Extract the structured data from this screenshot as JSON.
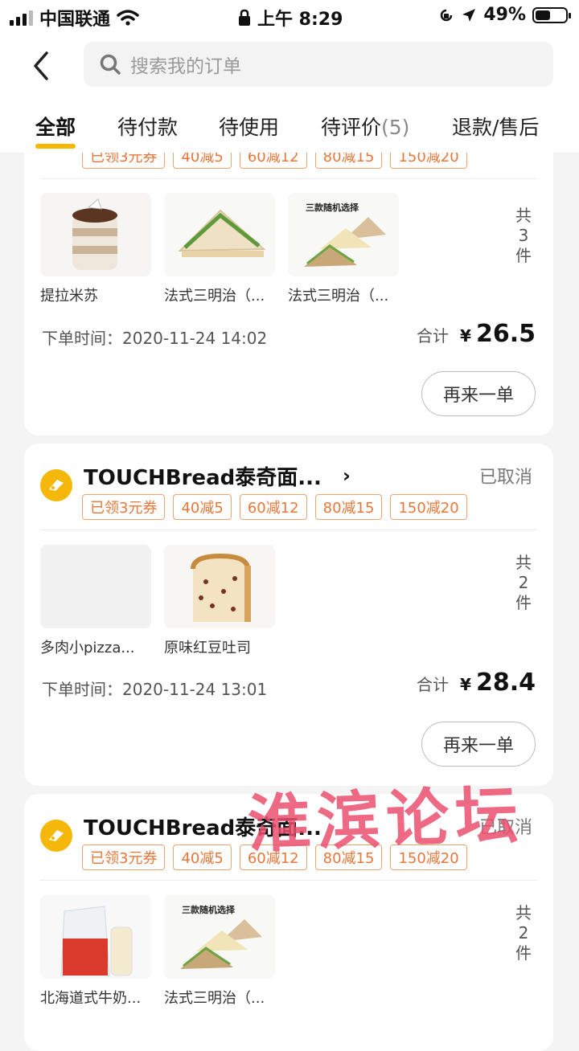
{
  "status_bar": {
    "carrier": "中国联通",
    "time": "上午 8:29",
    "battery": "49%",
    "battery_level": 0.49
  },
  "header": {
    "search_placeholder": "搜索我的订单",
    "tabs": [
      {
        "label": "全部",
        "count": "",
        "active": true
      },
      {
        "label": "待付款",
        "count": ""
      },
      {
        "label": "待使用",
        "count": ""
      },
      {
        "label": "待评价",
        "count": "(5)"
      },
      {
        "label": "退款/售后",
        "count": ""
      }
    ]
  },
  "orders": [
    {
      "shop_name": "",
      "status": "",
      "coupons": [
        "已领3元券",
        "40减5",
        "60减12",
        "80减15",
        "150减20"
      ],
      "items": [
        {
          "name": "提拉米苏",
          "image": "tiramisu"
        },
        {
          "name": "法式三明治（...",
          "image": "sandwich"
        },
        {
          "name": "法式三明治（...",
          "image": "sandwich-assorted",
          "caption": "三款随机选择"
        }
      ],
      "item_count": [
        "共",
        "3",
        "件"
      ],
      "order_time": "下单时间：2020-11-24 14:02",
      "total_label": "合计",
      "currency": "¥",
      "total": "26.5",
      "reorder_label": "再来一单"
    },
    {
      "shop_name": "TOUCHBread泰奇面...",
      "status": "已取消",
      "coupons": [
        "已领3元券",
        "40减5",
        "60减12",
        "80减15",
        "150减20"
      ],
      "items": [
        {
          "name": "多肉小pizza...",
          "image": "blank"
        },
        {
          "name": "原味红豆吐司",
          "image": "red-bean-toast"
        }
      ],
      "item_count": [
        "共",
        "2",
        "件"
      ],
      "order_time": "下单时间：2020-11-24 13:01",
      "total_label": "合计",
      "currency": "¥",
      "total": "28.4",
      "reorder_label": "再来一单"
    },
    {
      "shop_name": "TOUCHBread泰奇面...",
      "status": "已取消",
      "coupons": [
        "已领3元券",
        "40减5",
        "60减12",
        "80减15",
        "150减20"
      ],
      "items": [
        {
          "name": "北海道式牛奶...",
          "image": "milk-bread"
        },
        {
          "name": "法式三明治（...",
          "image": "sandwich-assorted",
          "caption": "三款随机选择"
        }
      ],
      "item_count": [
        "共",
        "2",
        "件"
      ]
    }
  ],
  "watermark": "淮滨论坛",
  "colors": {
    "accent": "#f6b800",
    "coupon": "#e9773a",
    "watermark": "#eb506e"
  }
}
